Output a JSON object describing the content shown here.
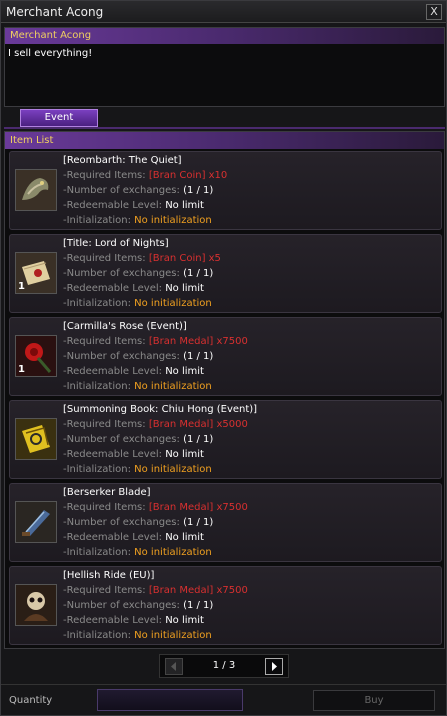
{
  "window": {
    "title": "Merchant Acong",
    "close_label": "X"
  },
  "npc": {
    "name": "Merchant Acong",
    "greeting": "I sell everything!"
  },
  "tabs": [
    {
      "label": "Event"
    }
  ],
  "item_list": {
    "header": "Item List",
    "labels": {
      "required": "-Required Items:",
      "exchanges": "-Number of exchanges:",
      "level": "-Redeemable Level:",
      "init": "-Initialization:"
    },
    "items": [
      {
        "name": "[Reombarth: The Quiet]",
        "required": "[Bran Coin] x10",
        "exchanges": "(1 / 1)",
        "level": "No limit",
        "init": "No initialization",
        "count": "",
        "icon": "dragon-icon"
      },
      {
        "name": "[Title: Lord of Nights]",
        "required": "[Bran Coin] x5",
        "exchanges": "(1 / 1)",
        "level": "No limit",
        "init": "No initialization",
        "count": "1",
        "icon": "scroll-icon"
      },
      {
        "name": "[Carmilla's Rose (Event)]",
        "required": "[Bran Medal] x7500",
        "exchanges": "(1 / 1)",
        "level": "No limit",
        "init": "No initialization",
        "count": "1",
        "icon": "rose-icon"
      },
      {
        "name": "[Summoning Book: Chiu Hong (Event)]",
        "required": "[Bran Medal] x5000",
        "exchanges": "(1 / 1)",
        "level": "No limit",
        "init": "No initialization",
        "count": "",
        "icon": "book-icon"
      },
      {
        "name": "[Berserker Blade]",
        "required": "[Bran Medal] x7500",
        "exchanges": "(1 / 1)",
        "level": "No limit",
        "init": "No initialization",
        "count": "",
        "icon": "blade-icon"
      },
      {
        "name": "[Hellish Ride (EU)]",
        "required": "[Bran Medal] x7500",
        "exchanges": "(1 / 1)",
        "level": "No limit",
        "init": "No initialization",
        "count": "",
        "icon": "skull-rider-icon"
      }
    ]
  },
  "pager": {
    "text": "1 / 3"
  },
  "footer": {
    "quantity_label": "Quantity",
    "quantity_value": "",
    "buy_label": "Buy"
  },
  "colors": {
    "accent_purple": "#6a3a9a",
    "header_gold": "#f0d060",
    "required_red": "#d83030",
    "init_orange": "#f0a020"
  }
}
